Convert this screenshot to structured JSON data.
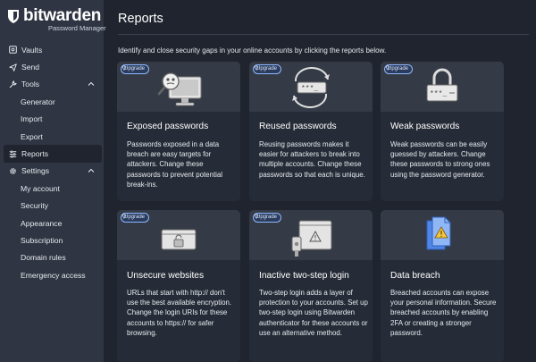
{
  "app": {
    "brand": "bitwarden",
    "brand_sub": "Password Manager"
  },
  "sidebar": {
    "items": [
      {
        "label": "Vaults",
        "icon": "vault-icon"
      },
      {
        "label": "Send",
        "icon": "send-icon"
      },
      {
        "label": "Tools",
        "icon": "wrench-icon",
        "expanded": true
      },
      {
        "label": "Generator"
      },
      {
        "label": "Import"
      },
      {
        "label": "Export"
      },
      {
        "label": "Reports",
        "icon": "reports-icon",
        "active": true
      },
      {
        "label": "Settings",
        "icon": "gear-icon",
        "expanded": true
      },
      {
        "label": "My account"
      },
      {
        "label": "Security"
      },
      {
        "label": "Appearance"
      },
      {
        "label": "Subscription"
      },
      {
        "label": "Domain rules"
      },
      {
        "label": "Emergency access"
      }
    ]
  },
  "main": {
    "title": "Reports",
    "description": "Identify and close security gaps in your online accounts by clicking the reports below.",
    "upgrade_label": "Upgrade",
    "cards": [
      {
        "title": "Exposed passwords",
        "body": "Passwords exposed in a data breach are easy targets for attackers. Change these passwords to prevent potential break-ins.",
        "upgrade": true
      },
      {
        "title": "Reused passwords",
        "body": "Reusing passwords makes it easier for attackers to break into multiple accounts. Change these passwords so that each is unique.",
        "upgrade": true
      },
      {
        "title": "Weak passwords",
        "body": "Weak passwords can be easily guessed by attackers. Change these passwords to strong ones using the password generator.",
        "upgrade": true
      },
      {
        "title": "Unsecure websites",
        "body": "URLs that start with http:// don't use the best available encryption. Change the login URIs for these accounts to https:// for safer browsing.",
        "upgrade": true
      },
      {
        "title": "Inactive two-step login",
        "body": "Two-step login adds a layer of protection to your accounts. Set up two-step login using Bitwarden authenticator for these accounts or use an alternative method.",
        "upgrade": true
      },
      {
        "title": "Data breach",
        "body": "Breached accounts can expose your personal information. Secure breached accounts by enabling 2FA or creating a stronger password.",
        "upgrade": false
      }
    ]
  },
  "colors": {
    "accent": "#8fb8ff",
    "sidebar_bg": "#2f3542",
    "main_bg": "#1f242e",
    "card_bg": "#262c37"
  }
}
